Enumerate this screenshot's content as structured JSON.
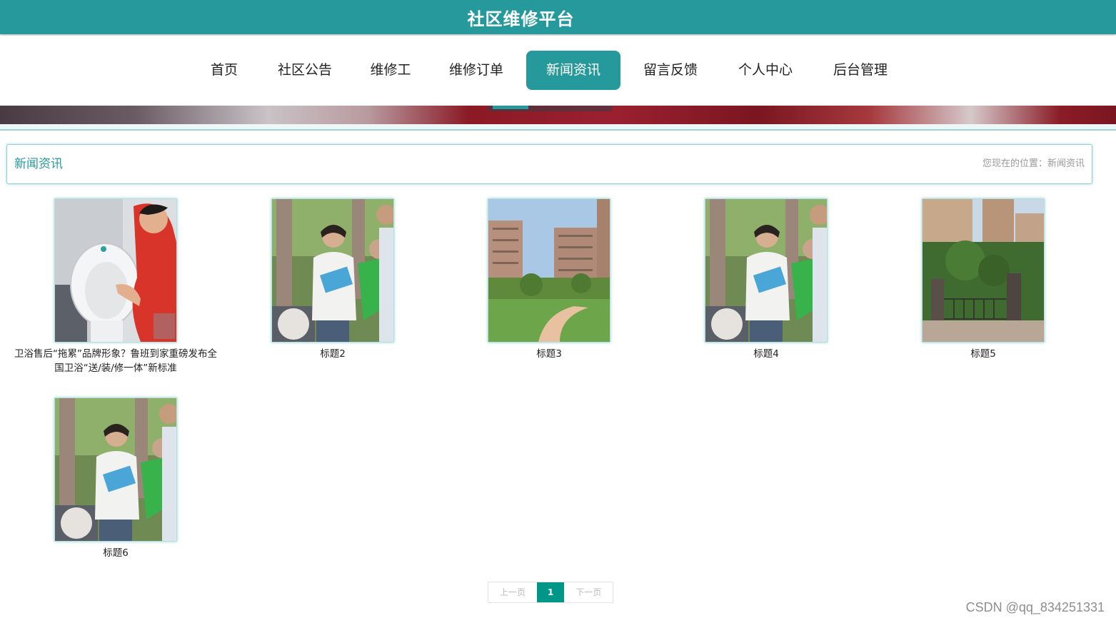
{
  "header": {
    "site_title": "社区维修平台"
  },
  "nav": {
    "items": [
      {
        "label": "首页"
      },
      {
        "label": "社区公告"
      },
      {
        "label": "维修工"
      },
      {
        "label": "维修订单"
      },
      {
        "label": "新闻资讯",
        "active": true
      },
      {
        "label": "留言反馈"
      },
      {
        "label": "个人中心"
      },
      {
        "label": "后台管理"
      }
    ]
  },
  "breadcrumb": {
    "title": "新闻资讯",
    "location": "您现在的位置：新闻资讯"
  },
  "news": [
    {
      "title": "卫浴售后“拖累”品牌形象？鲁班到家重磅发布全国卫浴“送/装/修一体”新标准",
      "image": "toilet-repair-photo"
    },
    {
      "title": "标题2",
      "image": "volunteer-crowd-photo"
    },
    {
      "title": "标题3",
      "image": "residential-towers-park-photo"
    },
    {
      "title": "标题4",
      "image": "volunteer-crowd-photo"
    },
    {
      "title": "标题5",
      "image": "community-gate-photo"
    },
    {
      "title": "标题6",
      "image": "volunteer-crowd-photo"
    }
  ],
  "pagination": {
    "prev_label": "上一页",
    "current_page": "1",
    "next_label": "下一页"
  },
  "watermark": "CSDN @qq_834251331",
  "colors": {
    "primary": "#26999c",
    "pager_active": "#009688"
  }
}
